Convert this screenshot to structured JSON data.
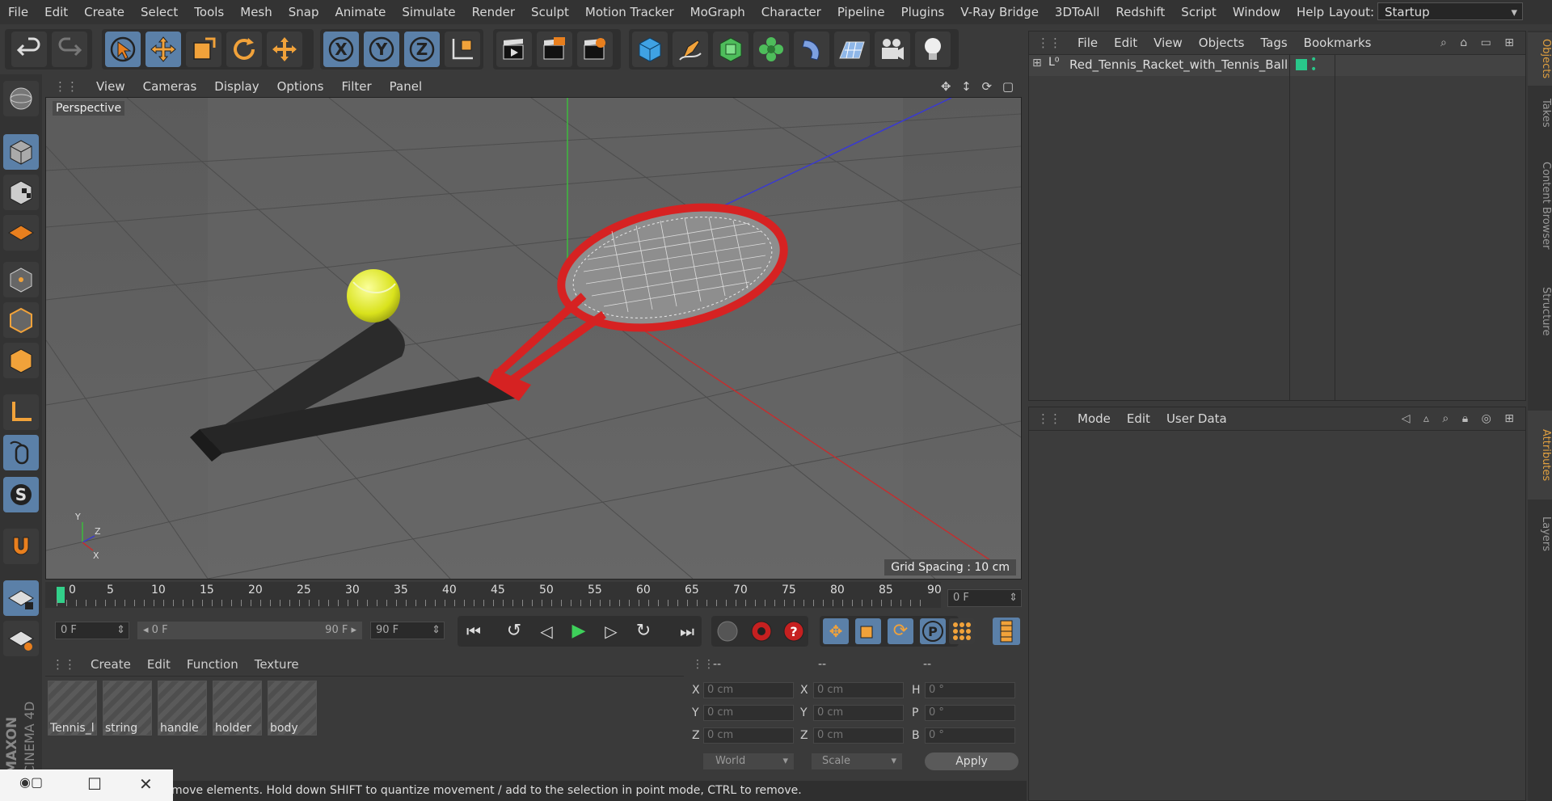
{
  "menu": [
    "File",
    "Edit",
    "Create",
    "Select",
    "Tools",
    "Mesh",
    "Snap",
    "Animate",
    "Simulate",
    "Render",
    "Sculpt",
    "Motion Tracker",
    "MoGraph",
    "Character",
    "Pipeline",
    "Plugins",
    "V-Ray Bridge",
    "3DToAll",
    "Redshift",
    "Script",
    "Window",
    "Help"
  ],
  "layout": {
    "label": "Layout:",
    "value": "Startup"
  },
  "axis_buttons": {
    "x": "X",
    "y": "Y",
    "z": "Z"
  },
  "viewport": {
    "menu": [
      "View",
      "Cameras",
      "Display",
      "Options",
      "Filter",
      "Panel"
    ],
    "label": "Perspective",
    "grid_spacing": "Grid Spacing : 10 cm",
    "axis_labels": {
      "x": "X",
      "y": "Y",
      "z": "Z"
    }
  },
  "timeline": {
    "ticks": [
      "0",
      "5",
      "10",
      "15",
      "20",
      "25",
      "30",
      "35",
      "40",
      "45",
      "50",
      "55",
      "60",
      "65",
      "70",
      "75",
      "80",
      "85",
      "90"
    ],
    "current_frame": "0 F",
    "start": "0 F",
    "range_start": "0 F",
    "range_end": "90 F",
    "end": "90 F"
  },
  "objects_panel": {
    "menu": [
      "File",
      "Edit",
      "View",
      "Objects",
      "Tags",
      "Bookmarks"
    ],
    "object_name": "Red_Tennis_Racket_with_Tennis_Ball",
    "tag_color": "#29c78a"
  },
  "attributes_panel": {
    "menu": [
      "Mode",
      "Edit",
      "User Data"
    ]
  },
  "side_tabs": [
    "Objects",
    "Takes",
    "Content Browser",
    "Structure",
    "Attributes",
    "Layers"
  ],
  "materials": {
    "menu": [
      "Create",
      "Edit",
      "Function",
      "Texture"
    ],
    "items": [
      "Tennis_l",
      "string",
      "handle",
      "holder",
      "body"
    ]
  },
  "coordinates": {
    "headers": [
      "--",
      "--",
      "--"
    ],
    "rows": [
      {
        "l1": "X",
        "v1": "0 cm",
        "l2": "X",
        "v2": "0 cm",
        "l3": "H",
        "v3": "0 °"
      },
      {
        "l1": "Y",
        "v1": "0 cm",
        "l2": "Y",
        "v2": "0 cm",
        "l3": "P",
        "v3": "0 °"
      },
      {
        "l1": "Z",
        "v1": "0 cm",
        "l2": "Z",
        "v2": "0 cm",
        "l3": "B",
        "v3": "0 °"
      }
    ],
    "mode": "World",
    "scale": "Scale",
    "apply": "Apply"
  },
  "status": "move elements. Hold down SHIFT to quantize movement / add to the selection in point mode, CTRL to remove.",
  "brand": {
    "maxon": "MAXON",
    "product": "CINEMA 4D"
  }
}
